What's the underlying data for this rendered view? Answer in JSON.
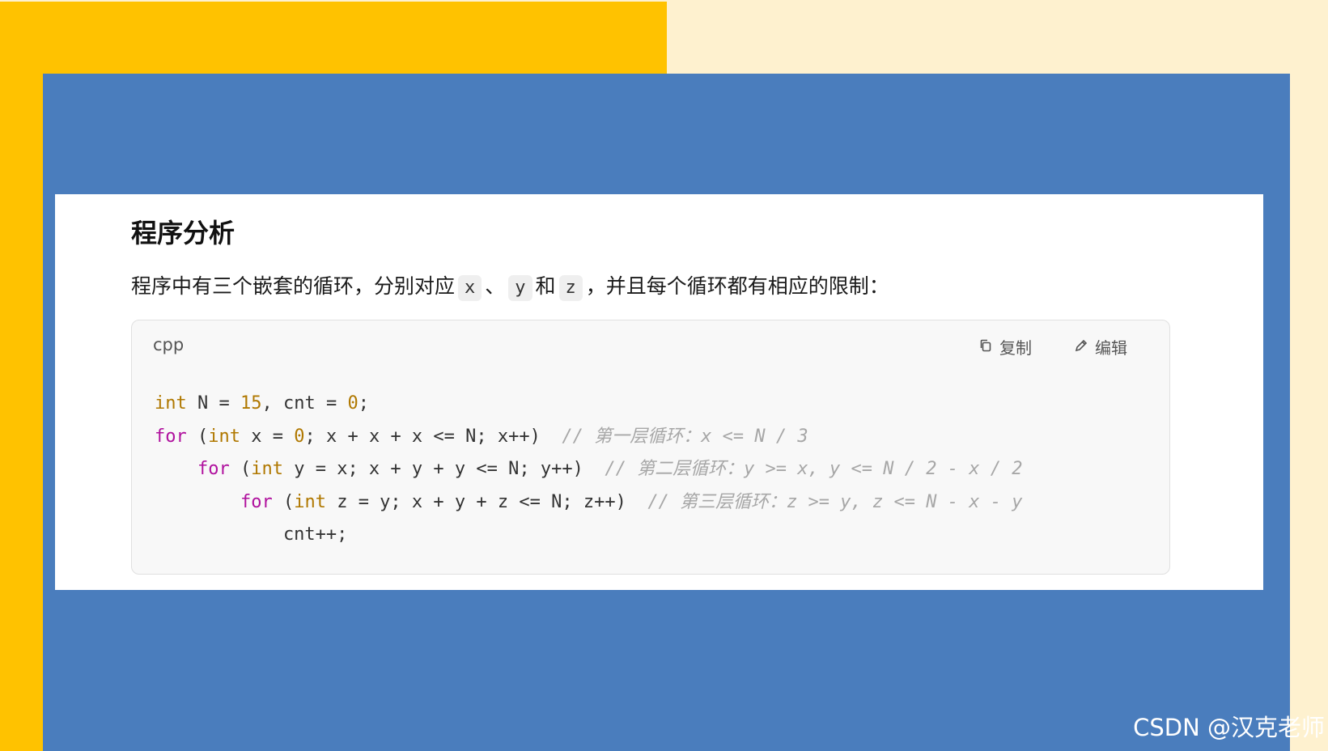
{
  "heading": "程序分析",
  "description": {
    "pre": "程序中有三个嵌套的循环，分别对应",
    "var_x": "x",
    "sep1": "、",
    "var_y": "y",
    "sep2": "和",
    "var_z": "z",
    "post": "，并且每个循环都有相应的限制："
  },
  "code_block": {
    "language": "cpp",
    "copy_label": "复制",
    "edit_label": "编辑",
    "lines": [
      {
        "indent": 0,
        "tokens": [
          {
            "t": "type",
            "v": "int"
          },
          {
            "t": "txt",
            "v": " N = "
          },
          {
            "t": "num",
            "v": "15"
          },
          {
            "t": "txt",
            "v": ", cnt = "
          },
          {
            "t": "num",
            "v": "0"
          },
          {
            "t": "txt",
            "v": ";"
          }
        ]
      },
      {
        "indent": 0,
        "tokens": [
          {
            "t": "ctrl",
            "v": "for"
          },
          {
            "t": "txt",
            "v": " ("
          },
          {
            "t": "type",
            "v": "int"
          },
          {
            "t": "txt",
            "v": " x = "
          },
          {
            "t": "num",
            "v": "0"
          },
          {
            "t": "txt",
            "v": "; x + x + x <= N; x++)  "
          },
          {
            "t": "cmt",
            "v": "// 第一层循环：x <= N / 3"
          }
        ]
      },
      {
        "indent": 1,
        "tokens": [
          {
            "t": "ctrl",
            "v": "for"
          },
          {
            "t": "txt",
            "v": " ("
          },
          {
            "t": "type",
            "v": "int"
          },
          {
            "t": "txt",
            "v": " y = x; x + y + y <= N; y++)  "
          },
          {
            "t": "cmt",
            "v": "// 第二层循环：y >= x, y <= N / 2 - x / 2"
          }
        ]
      },
      {
        "indent": 2,
        "tokens": [
          {
            "t": "ctrl",
            "v": "for"
          },
          {
            "t": "txt",
            "v": " ("
          },
          {
            "t": "type",
            "v": "int"
          },
          {
            "t": "txt",
            "v": " z = y; x + y + z <= N; z++)  "
          },
          {
            "t": "cmt",
            "v": "// 第三层循环：z >= y, z <= N - x - y"
          }
        ]
      },
      {
        "indent": 3,
        "tokens": [
          {
            "t": "txt",
            "v": "cnt++;"
          }
        ]
      }
    ]
  },
  "watermark": "CSDN @汉克老师",
  "colors": {
    "orange_background": "#ffc200",
    "cream_background": "#fef1cf",
    "blue_panel": "#4a7dbd",
    "keyword_type": "#b07800",
    "keyword_control": "#b0119e",
    "comment": "#a7a7a7"
  },
  "icons": {
    "copy": "copy-icon",
    "edit": "edit-icon"
  }
}
